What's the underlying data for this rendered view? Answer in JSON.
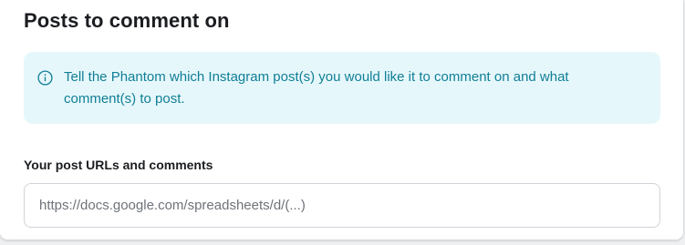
{
  "section": {
    "title": "Posts to comment on"
  },
  "info": {
    "icon": "info-circle-icon",
    "text": "Tell the Phantom which Instagram post(s) you would like it to comment on and what comment(s) to post."
  },
  "field": {
    "label": "Your post URLs and comments",
    "value": "",
    "placeholder": "https://docs.google.com/spreadsheets/d/(...)"
  },
  "colors": {
    "info_background": "#e6f7fb",
    "info_text": "#0f7f95",
    "title_text": "#1b1d21",
    "input_border": "#cfd3d8"
  }
}
